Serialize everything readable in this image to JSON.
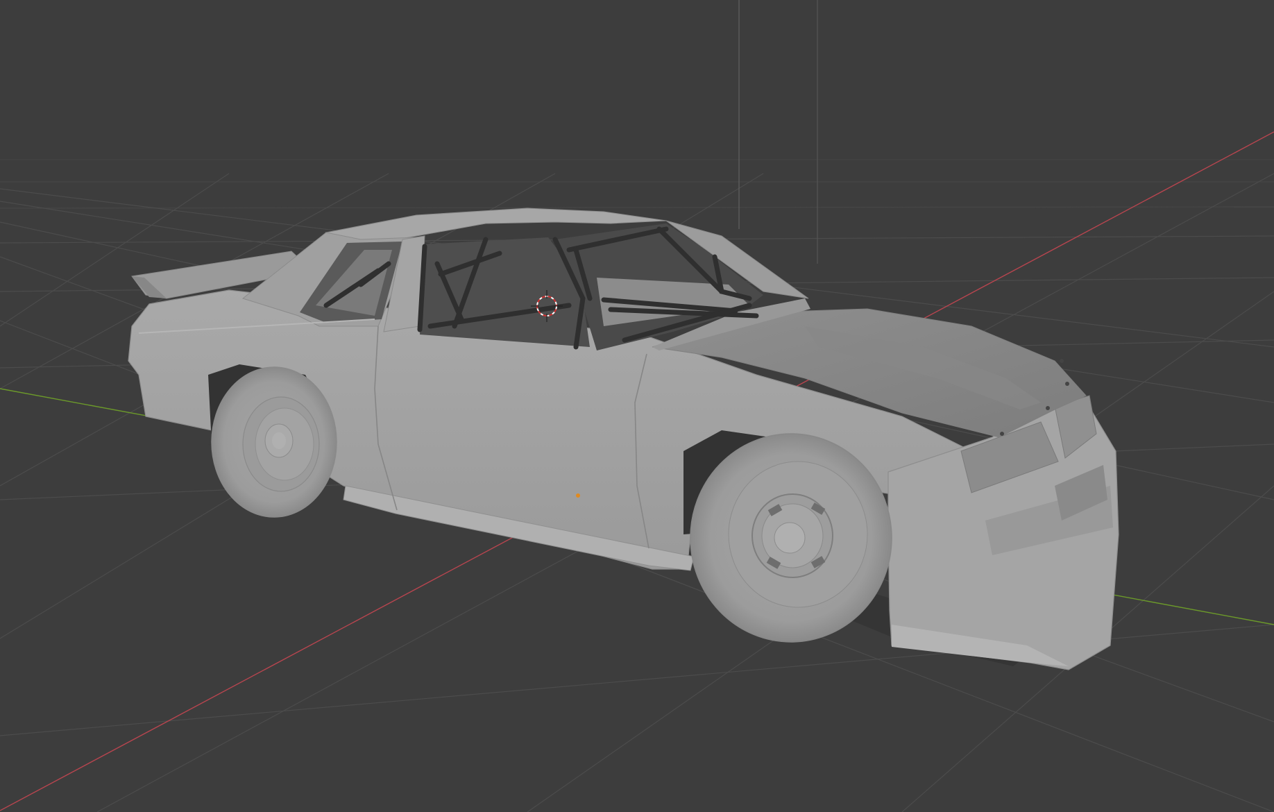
{
  "viewport": {
    "background_color": "#3d3d3d",
    "grid_color": "#4a4a4a",
    "x_axis_color": "#b8454f",
    "y_axis_color": "#6c9a2a",
    "z_axis_color": "#5a5a5a",
    "model_color": "#a2a2a2",
    "roll_cage_color": "#333333"
  },
  "scene": {
    "object": "race-car-body",
    "shading": "solid",
    "cursor": "3d-cursor-icon",
    "origin": "object-origin-icon"
  }
}
